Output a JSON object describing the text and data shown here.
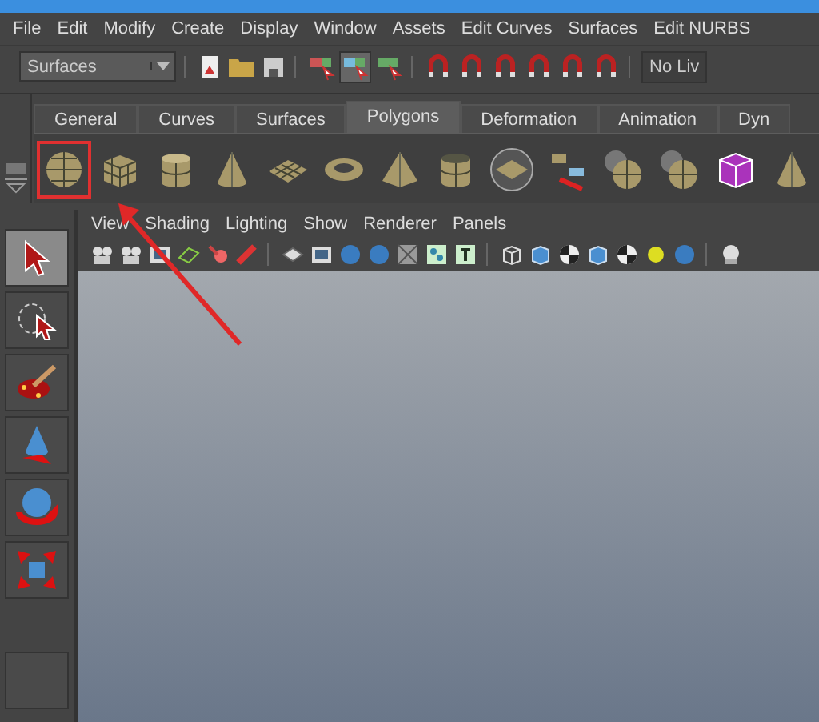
{
  "menu_bar": [
    "File",
    "Edit",
    "Modify",
    "Create",
    "Display",
    "Window",
    "Assets",
    "Edit Curves",
    "Surfaces",
    "Edit NURBS"
  ],
  "toolbar": {
    "menu_set": "Surfaces",
    "live_field": "No Liv"
  },
  "shelf": {
    "tabs": [
      {
        "label": "General",
        "selected": false
      },
      {
        "label": "Curves",
        "selected": false
      },
      {
        "label": "Surfaces",
        "selected": false
      },
      {
        "label": "Polygons",
        "selected": true
      },
      {
        "label": "Deformation",
        "selected": false
      },
      {
        "label": "Animation",
        "selected": false
      },
      {
        "label": "Dyn",
        "selected": false
      }
    ],
    "items": [
      {
        "kind": "sphere",
        "selected": true
      },
      {
        "kind": "cube",
        "selected": false
      },
      {
        "kind": "cylinder",
        "selected": false
      },
      {
        "kind": "cone",
        "selected": false
      },
      {
        "kind": "plane",
        "selected": false
      },
      {
        "kind": "torus",
        "selected": false
      },
      {
        "kind": "pyramid",
        "selected": false
      },
      {
        "kind": "pipe",
        "selected": false
      },
      {
        "kind": "ringed-plane",
        "selected": false
      },
      {
        "kind": "tiles",
        "selected": false
      },
      {
        "kind": "sphere-pair",
        "selected": false
      },
      {
        "kind": "sphere-pair",
        "selected": false
      },
      {
        "kind": "crystal",
        "selected": false
      },
      {
        "kind": "cone",
        "selected": false
      }
    ]
  },
  "panel_menu": [
    "View",
    "Shading",
    "Lighting",
    "Show",
    "Renderer",
    "Panels"
  ],
  "tools": [
    {
      "kind": "select",
      "selected": true
    },
    {
      "kind": "lasso",
      "selected": false
    },
    {
      "kind": "paint",
      "selected": false
    },
    {
      "kind": "move",
      "selected": false
    },
    {
      "kind": "rotate",
      "selected": false
    },
    {
      "kind": "scale",
      "selected": false
    },
    {
      "kind": "empty",
      "selected": false
    }
  ]
}
